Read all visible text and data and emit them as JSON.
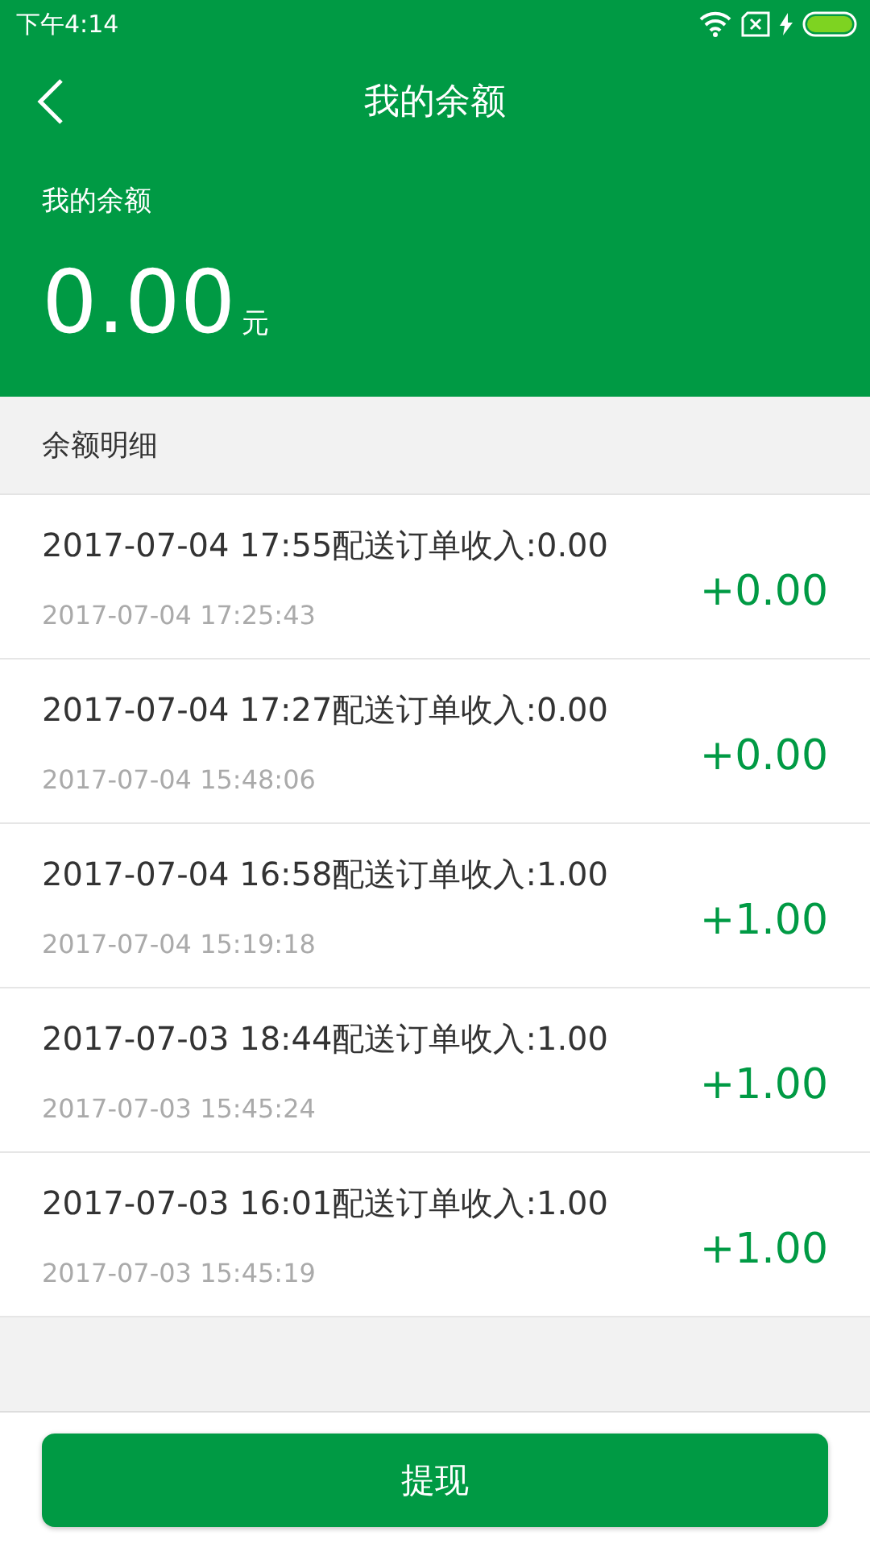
{
  "status_bar": {
    "time": "下午4:14"
  },
  "header": {
    "title": "我的余额"
  },
  "balance": {
    "label": "我的余额",
    "amount": "0.00",
    "unit": "元"
  },
  "section": {
    "title": "余额明细"
  },
  "records": [
    {
      "title": "2017-07-04 17:55配送订单收入:0.00",
      "time": "2017-07-04 17:25:43",
      "amount": "+0.00"
    },
    {
      "title": "2017-07-04 17:27配送订单收入:0.00",
      "time": "2017-07-04 15:48:06",
      "amount": "+0.00"
    },
    {
      "title": "2017-07-04 16:58配送订单收入:1.00",
      "time": "2017-07-04 15:19:18",
      "amount": "+1.00"
    },
    {
      "title": "2017-07-03 18:44配送订单收入:1.00",
      "time": "2017-07-03 15:45:24",
      "amount": "+1.00"
    },
    {
      "title": "2017-07-03 16:01配送订单收入:1.00",
      "time": "2017-07-03 15:45:19",
      "amount": "+1.00"
    }
  ],
  "footer": {
    "button": "提现"
  }
}
